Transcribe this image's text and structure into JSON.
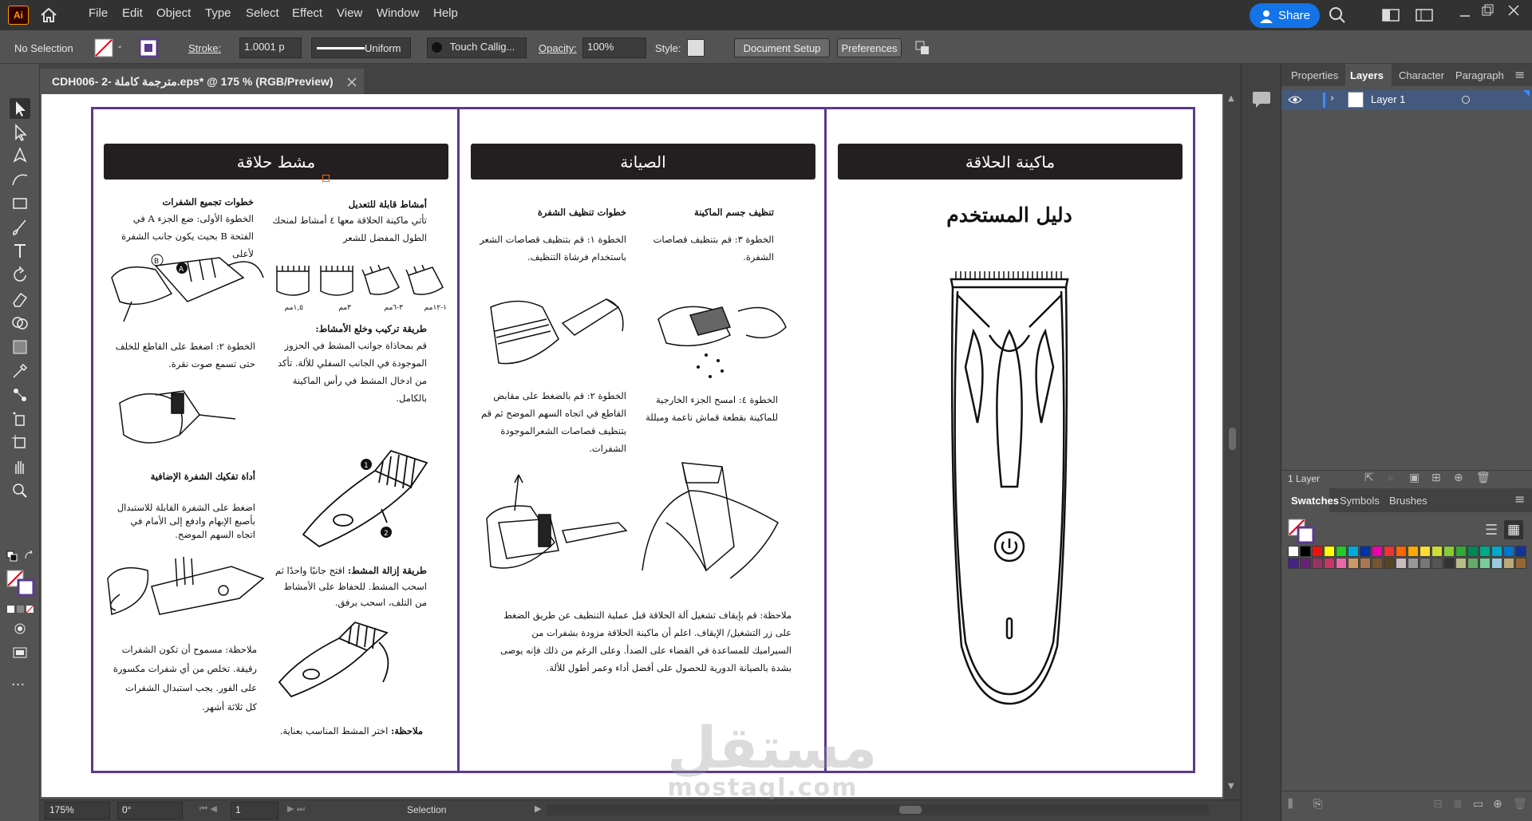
{
  "app": {
    "logo": "Ai"
  },
  "menu": [
    "File",
    "Edit",
    "Object",
    "Type",
    "Select",
    "Effect",
    "View",
    "Window",
    "Help"
  ],
  "share": {
    "label": "Share"
  },
  "control": {
    "selection": "No Selection",
    "stroke_label": "Stroke:",
    "stroke_value": "1.0001 p",
    "profile": "Uniform",
    "brush": "Touch Callig...",
    "opacity_label": "Opacity:",
    "opacity_value": "100%",
    "style_label": "Style:",
    "doc_setup": "Document Setup",
    "preferences": "Preferences"
  },
  "document": {
    "tab": "CDH006- 2- مترجمة كاملة.eps* @ 175 % (RGB/Preview)"
  },
  "artwork": {
    "panel_left": {
      "title": "مشط حلاقة",
      "combs_head": "أمشاط قابلة للتعديل",
      "combs_text": "تأتي ماكينة الحلاقة معها ٤ أمشاط لمنحك الطول المفضل للشعر",
      "sizes": [
        "١-١٢مم",
        "٣-٦مم",
        "٣مم",
        "١,٥مم"
      ],
      "mount_head": "طريقة تركيب وخلع الأمشاط:",
      "mount_text": "قم بمحاذاة جوانب المشط في الحزوز الموجودة في الجانب السفلي للألة. تأكد من ادخال المشط في رأس الماكينة بالكامل.",
      "blade_head": "خطوات تجميع الشفرات",
      "step1": "الخطوة الأولى: ضع الجزء A في الفتحة B بحيث يكون جانب الشفرة لأعلى",
      "step2": "الخطوة ٢: اضغط على القاطع للخلف حتى تسمع صوت نقرة.",
      "detach_head": "أداة تفكيك الشفرة الإضافية",
      "detach_text": "اضغط على الشفرة القابلة للاستبدال بأصبع الإبهام وادفع إلى الأمام في اتجاه السهم الموضح.",
      "remove_head": "طريقة إزالة المشط:",
      "remove_text": "افتح جانبًا واحدًا ثم اسحب المشط. للحفاظ على الأمشاط من التلف، اسحب برفق.",
      "note1": "ملاحظة: مسموح أن تكون الشفرات رقيقة. تخلص من أي شفرات مكسورة على الفور. يجب استبدال الشفرات كل ثلاثة أشهر.",
      "note2_head": "ملاحظة:",
      "note2_text": "اختر المشط المناسب بعناية."
    },
    "panel_mid": {
      "title": "الصيانة",
      "body_head": "تنظيف جسم الماكينة",
      "clean_head": "خطوات تنظيف الشفرة",
      "step3": "الخطوة ٣: قم بتنظيف قصاصات الشفرة.",
      "step1": "الخطوة ١: قم بتنظيف قصاصات الشعر باستخدام فرشاة التنظيف.",
      "step4": "الخطوة ٤: امسح الجزء الخارجية للماكينة بقطعة قماش ناعمة ومبللة",
      "step2": "الخطوة ٢: قم بالضغط على مقابض القاطع في اتجاه السهم الموضح ثم قم بتنظيف قصاصات الشعرالموجودة الشفرات.",
      "note": "ملاحظة: قم بإيقاف تشغيل آلة الحلاقة قبل عملية التنظيف عن طريق الضغط على زر التشغيل/ الإيقاف. اعلم أن ماكينة الحلاقة مزودة بشفرات من السيراميك للمساعدة في القضاء على الصدأ. وعلى الرغم من ذلك فإنه يوصى بشدة بالصيانة الدورية للحصول على أفضل أداء وعمر أطول للألة."
    },
    "panel_right": {
      "title": "ماكينة الحلاقة",
      "subtitle": "دليل المستخدم"
    },
    "callouts": [
      "1",
      "2",
      "A",
      "B"
    ]
  },
  "status": {
    "zoom": "175%",
    "rotate": "0°",
    "artboard": "1",
    "tool": "Selection"
  },
  "panels": {
    "tabs": [
      "Properties",
      "Layers",
      "Character",
      "Paragraph"
    ],
    "layer": "Layer 1",
    "layer_count": "1 Layer",
    "swatch_tabs": [
      "Swatches",
      "Symbols",
      "Brushes"
    ]
  },
  "watermark": {
    "text": "مستقل",
    "sub": "mostaql.com"
  },
  "colors": {
    "accent": "#1473e6",
    "frame": "#5b3a8c",
    "ai": "#ff9a00"
  }
}
